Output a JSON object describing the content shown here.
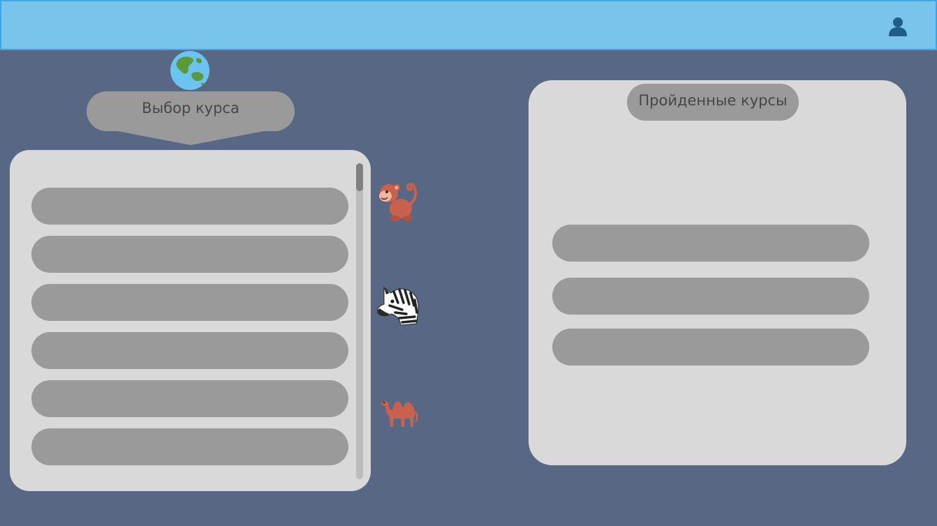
{
  "header": {
    "user_icon": "user-silhouette-icon"
  },
  "course_select": {
    "title": "Выбор курса",
    "globe_icon": "globe-icon",
    "rows_count": 6
  },
  "animals": [
    "monkey-icon",
    "zebra-icon",
    "camel-icon"
  ],
  "completed_courses": {
    "title": "Пройденные курсы",
    "rows_count": 3
  },
  "colors": {
    "background": "#586884",
    "header": "#79c4eb",
    "header_border": "#3ba7ea",
    "panel": "#d9d9d9",
    "pill": "#9a9a9a",
    "pill_text": "#474747"
  }
}
